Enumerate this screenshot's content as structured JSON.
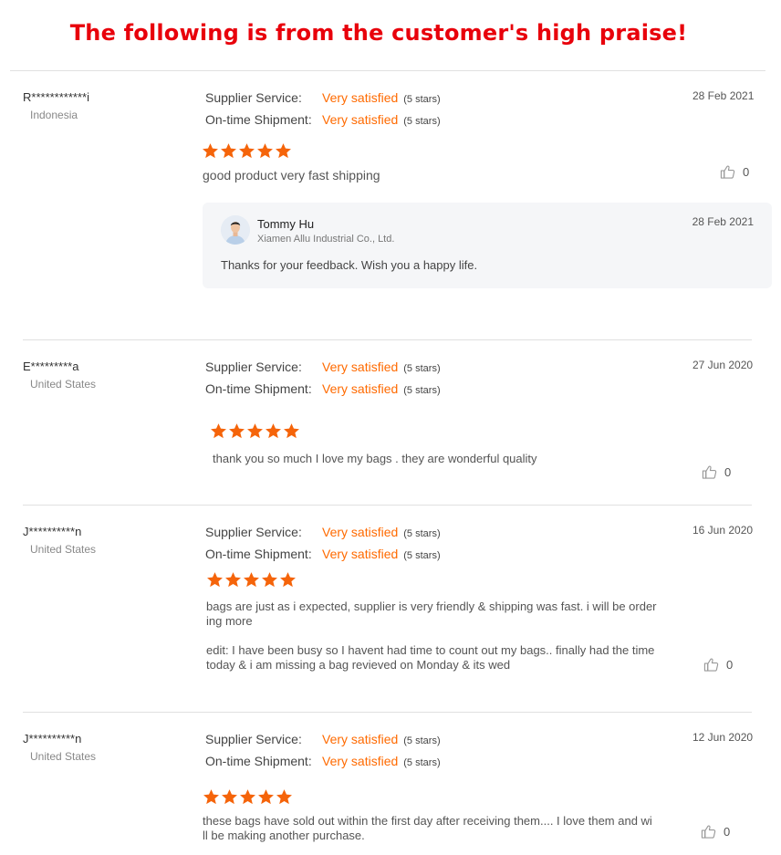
{
  "banner": "The following is from the customer's high praise!",
  "colors": {
    "accent": "#ff6a00",
    "banner": "#e8000b",
    "star": "#f5640a"
  },
  "icons": {
    "star": "star-icon",
    "like": "thumbs-up-icon"
  },
  "reviews": [
    {
      "buyer": "R************i",
      "country": "Indonesia",
      "supplier_label": "Supplier Service:",
      "supplier_value": "Very satisfied",
      "supplier_stars": "(5 stars)",
      "shipment_label": "On-time Shipment:",
      "shipment_value": "Very satisfied",
      "shipment_stars": "(5 stars)",
      "date": "28 Feb 2021",
      "rating": 5,
      "comment": "good product very fast shipping",
      "likes": "0",
      "reply": {
        "name": "Tommy Hu",
        "company": "Xiamen Allu Industrial Co., Ltd.",
        "date": "28 Feb 2021",
        "text": "Thanks for your feedback. Wish you a happy life."
      }
    },
    {
      "buyer": "E*********a",
      "country": "United States",
      "supplier_label": "Supplier Service:",
      "supplier_value": "Very satisfied",
      "supplier_stars": "(5 stars)",
      "shipment_label": "On-time Shipment:",
      "shipment_value": "Very satisfied",
      "shipment_stars": "(5 stars)",
      "date": "27 Jun 2020",
      "rating": 5,
      "comment": "thank you so much I love my bags . they are wonderful quality",
      "likes": "0"
    },
    {
      "buyer": "J**********n",
      "country": "United States",
      "supplier_label": "Supplier Service:",
      "supplier_value": "Very satisfied",
      "supplier_stars": "(5 stars)",
      "shipment_label": "On-time Shipment:",
      "shipment_value": "Very satisfied",
      "shipment_stars": "(5 stars)",
      "date": "16 Jun 2020",
      "rating": 5,
      "comment_line1": "bags are just as i expected, supplier is very friendly & shipping was fast. i will be order",
      "comment_line2": "ing more",
      "edit_line1": "edit: I have been busy so I havent had time to count out my bags.. finally had the time",
      "edit_line2": "today & i am missing a bag revieved on Monday & its wed",
      "likes": "0"
    },
    {
      "buyer": "J**********n",
      "country": "United States",
      "supplier_label": "Supplier Service:",
      "supplier_value": "Very satisfied",
      "supplier_stars": "(5 stars)",
      "shipment_label": "On-time Shipment:",
      "shipment_value": "Very satisfied",
      "shipment_stars": "(5 stars)",
      "date": "12 Jun 2020",
      "rating": 5,
      "comment_line1": "these bags have sold out within the first day after receiving them.... I love them and wi",
      "comment_line2": "ll be making another purchase.",
      "likes": "0"
    }
  ]
}
